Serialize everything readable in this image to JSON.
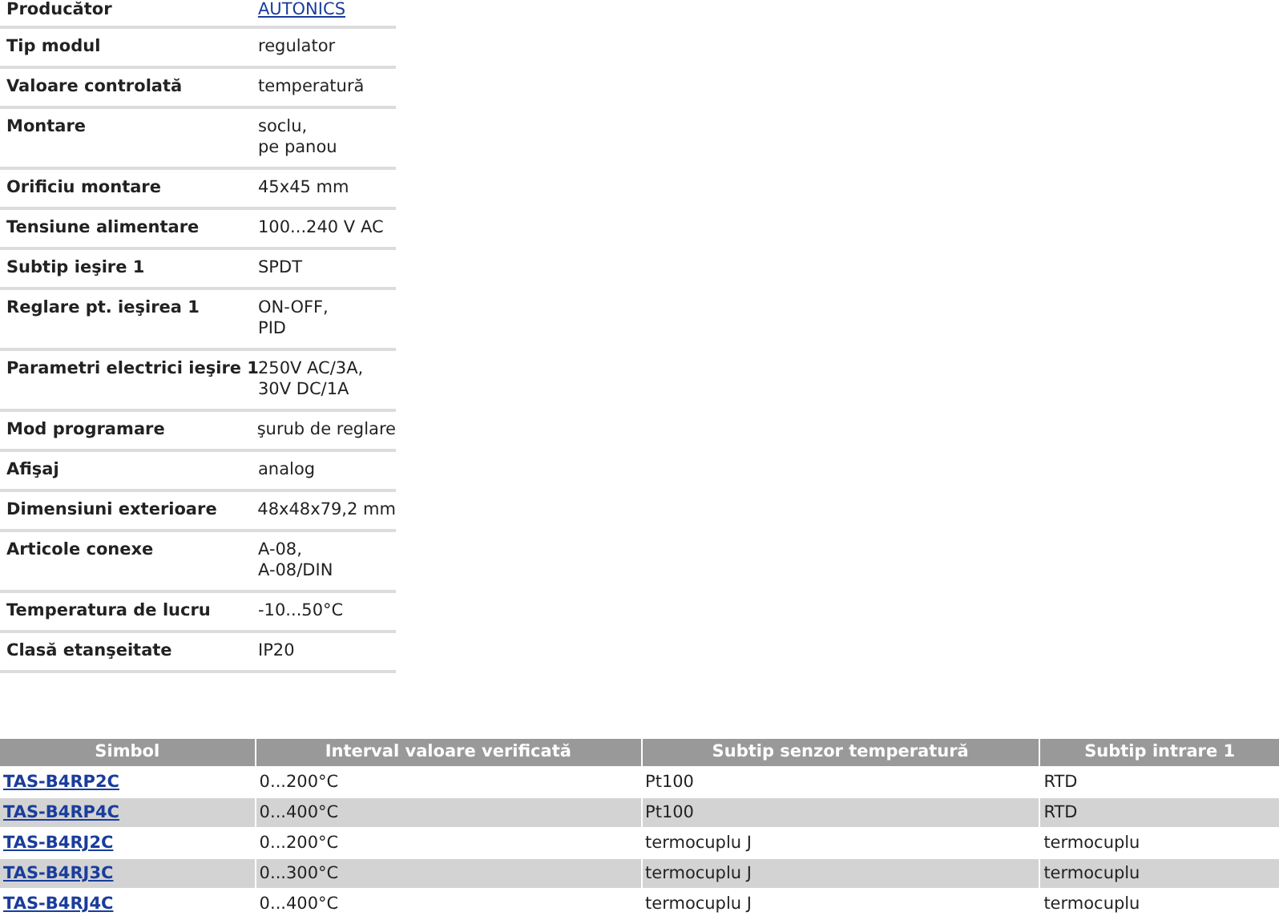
{
  "specs": [
    {
      "label": "Producător",
      "value": "AUTONICS",
      "link": true
    },
    {
      "label": "Tip modul",
      "value": "regulator",
      "link": false
    },
    {
      "label": "Valoare controlată",
      "value": "temperatură",
      "link": false
    },
    {
      "label": "Montare",
      "value": "soclu,\npe panou",
      "link": false
    },
    {
      "label": "Orificiu montare",
      "value": "45x45 mm",
      "link": false
    },
    {
      "label": "Tensiune alimentare",
      "value": "100...240 V AC",
      "link": false
    },
    {
      "label": "Subtip ieşire 1",
      "value": "SPDT",
      "link": false
    },
    {
      "label": "Reglare pt. ieşirea 1",
      "value": "ON-OFF,\nPID",
      "link": false
    },
    {
      "label": "Parametri electrici ieşire 1",
      "value": "250V AC/3A,\n30V DC/1A",
      "link": false
    },
    {
      "label": "Mod programare",
      "value": "şurub de reglare",
      "link": false
    },
    {
      "label": "Afişaj",
      "value": "analog",
      "link": false
    },
    {
      "label": "Dimensiuni exterioare",
      "value": "48x48x79,2 mm",
      "link": false
    },
    {
      "label": "Articole conexe",
      "value": "A-08,\nA-08/DIN",
      "link": false
    },
    {
      "label": "Temperatura de lucru",
      "value": "-10...50°C",
      "link": false
    },
    {
      "label": "Clasă etanşeitate",
      "value": "IP20",
      "link": false
    }
  ],
  "table": {
    "columns": [
      "Simbol",
      "Interval valoare verificată",
      "Subtip senzor temperatură",
      "Subtip intrare 1"
    ],
    "rows": [
      [
        "TAS-B4RP2C",
        "0...200°C",
        "Pt100",
        "RTD"
      ],
      [
        "TAS-B4RP4C",
        "0...400°C",
        "Pt100",
        "RTD"
      ],
      [
        "TAS-B4RJ2C",
        "0...200°C",
        "termocuplu J",
        "termocuplu"
      ],
      [
        "TAS-B4RJ3C",
        "0...300°C",
        "termocuplu J",
        "termocuplu"
      ],
      [
        "TAS-B4RJ4C",
        "0...400°C",
        "termocuplu J",
        "termocuplu"
      ]
    ]
  }
}
